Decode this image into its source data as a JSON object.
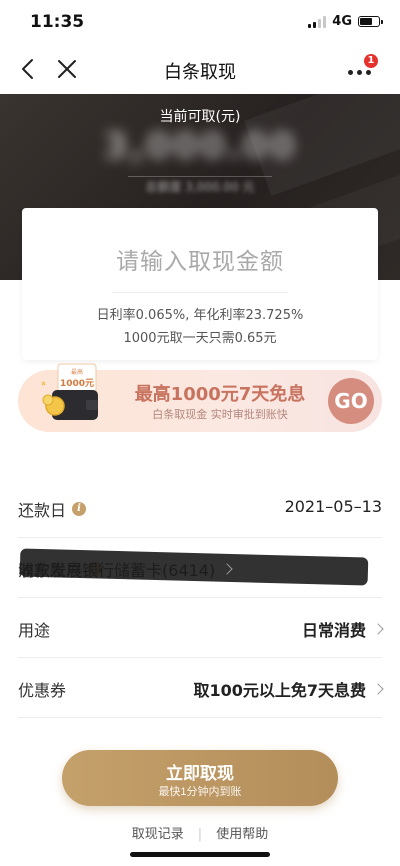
{
  "status_bar": {
    "time": "11:35",
    "network": "4G"
  },
  "nav": {
    "title": "白条取现",
    "more_badge": "1"
  },
  "hero": {
    "label": "当前可取(元)",
    "amount": "3,000.00",
    "total": "总额度 3,000.00 元"
  },
  "card": {
    "placeholder": "请输入取现金额",
    "rate_line1": "日利率0.065%, 年化利率23.725%",
    "rate_line2": "1000元取一天只需0.65元"
  },
  "promo": {
    "coupon_label": "最高",
    "coupon_amount": "1000元",
    "title": "最高1000元7天免息",
    "subtitle": "白条取现金 实时审批到账快",
    "go_label": "GO"
  },
  "form": {
    "repayment_label": "还款日",
    "repayment_value": "2021–05–13",
    "account_label": "收款账户",
    "account_value": "浦东发展银行储蓄卡(6414)",
    "purpose_label": "用途",
    "purpose_value": "日常消费",
    "coupon_label": "优惠券",
    "coupon_value": "取100元以上免7天息费"
  },
  "submit": {
    "label": "立即取现",
    "sublabel": "最快1分钟内到账"
  },
  "footer": {
    "records": "取现记录",
    "separator": "|",
    "help": "使用帮助"
  },
  "colors": {
    "accent_gold": "#c4a06b",
    "promo_text": "#c8735f",
    "badge_red": "#e5322d",
    "hero_dark": "#2a2523"
  }
}
